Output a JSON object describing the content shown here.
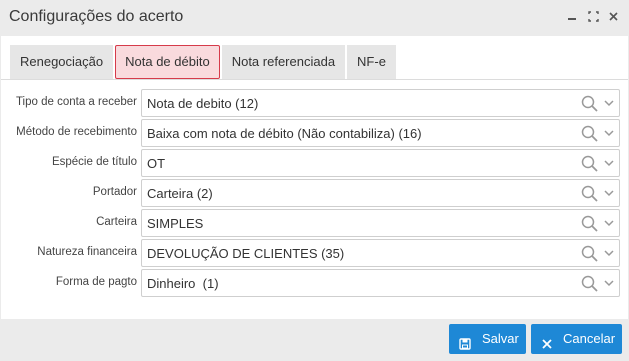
{
  "window": {
    "title": "Configurações do acerto",
    "minimize_icon": "minimize-icon",
    "maximize_icon": "maximize-icon",
    "close_icon": "close-icon"
  },
  "tabs": [
    {
      "label": "Renegociação",
      "active": false
    },
    {
      "label": "Nota de débito",
      "active": true
    },
    {
      "label": "Nota referenciada",
      "active": false
    },
    {
      "label": "NF-e",
      "active": false
    }
  ],
  "form": {
    "rows": [
      {
        "label": "Tipo de conta a receber",
        "value": "Nota de debito (12)"
      },
      {
        "label": "Método de recebimento",
        "value": "Baixa com nota de débito (Não contabiliza) (16)"
      },
      {
        "label": "Espécie de título",
        "value": "OT"
      },
      {
        "label": "Portador",
        "value": "Carteira (2)"
      },
      {
        "label": "Carteira",
        "value": "SIMPLES"
      },
      {
        "label": "Natureza financeira",
        "value": "DEVOLUÇÃO DE CLIENTES (35)"
      },
      {
        "label": "Forma de pagto",
        "value": "Dinheiro  (1)"
      }
    ],
    "search_icon": "search-icon",
    "chevron_icon": "chevron-down-icon"
  },
  "footer": {
    "save_label": "Salvar",
    "save_icon": "save-icon",
    "cancel_label": "Cancelar",
    "cancel_icon": "close-icon"
  },
  "colors": {
    "primary_button": "#1e88d6",
    "active_tab_border": "#d63a4a",
    "active_tab_bg": "#f9dadd"
  }
}
